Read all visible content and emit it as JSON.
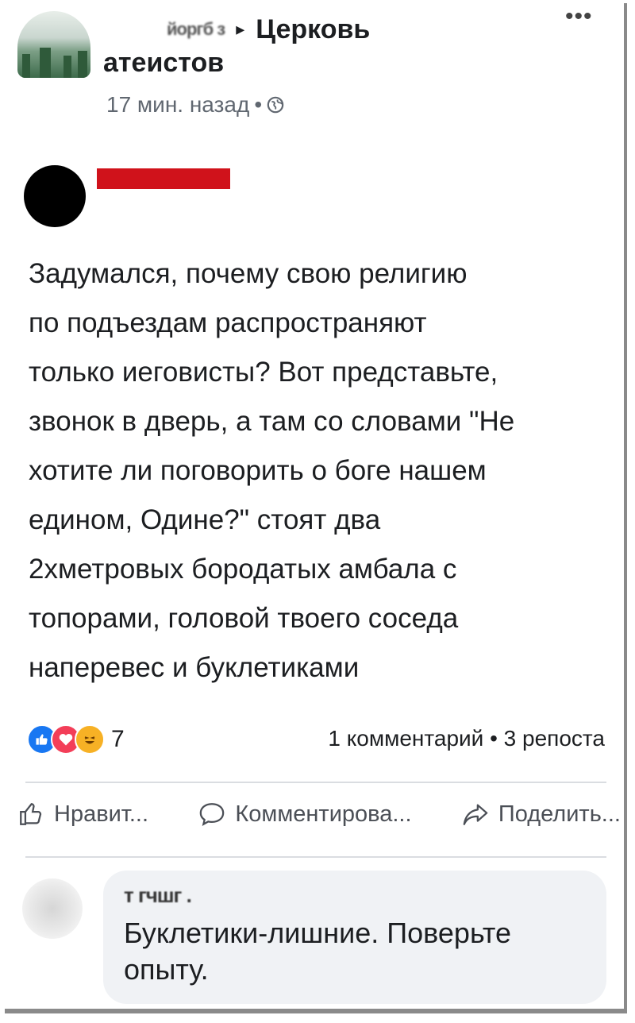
{
  "header": {
    "author_name": "йоргб з",
    "group_line1": "Церковь",
    "group_line2": "атеистов",
    "arrow": "▸",
    "more": "•••",
    "timestamp": "17 мин. назад",
    "separator": "•"
  },
  "post": {
    "text": "Задумался, почему свою религию\nпо подъездам распространяют\nтолько иеговисты? Вот представьте,\nзвонок в дверь, а там со словами \"Не\nхотите ли поговорить о боге нашем\nедином, Одине?\" стоят два\n2хметровых бородатых амбала с\nтопорами, головой твоего соседа\nнаперевес и буклетиками"
  },
  "reactions": {
    "count": "7",
    "icons": [
      "like-icon",
      "love-icon",
      "haha-icon"
    ],
    "stats": "1 комментарий • 3 репоста"
  },
  "actions": {
    "like": "Нравит...",
    "comment": "Комментирова...",
    "share": "Поделить..."
  },
  "comment": {
    "author": "т гчшг .",
    "text": "Буклетики-лишние. Поверьте\nопыту."
  },
  "colors": {
    "redaction_bar": "#d0121b",
    "like_blue": "#1877f2",
    "love_red": "#f33e58",
    "haha_yellow": "#f7b125"
  }
}
